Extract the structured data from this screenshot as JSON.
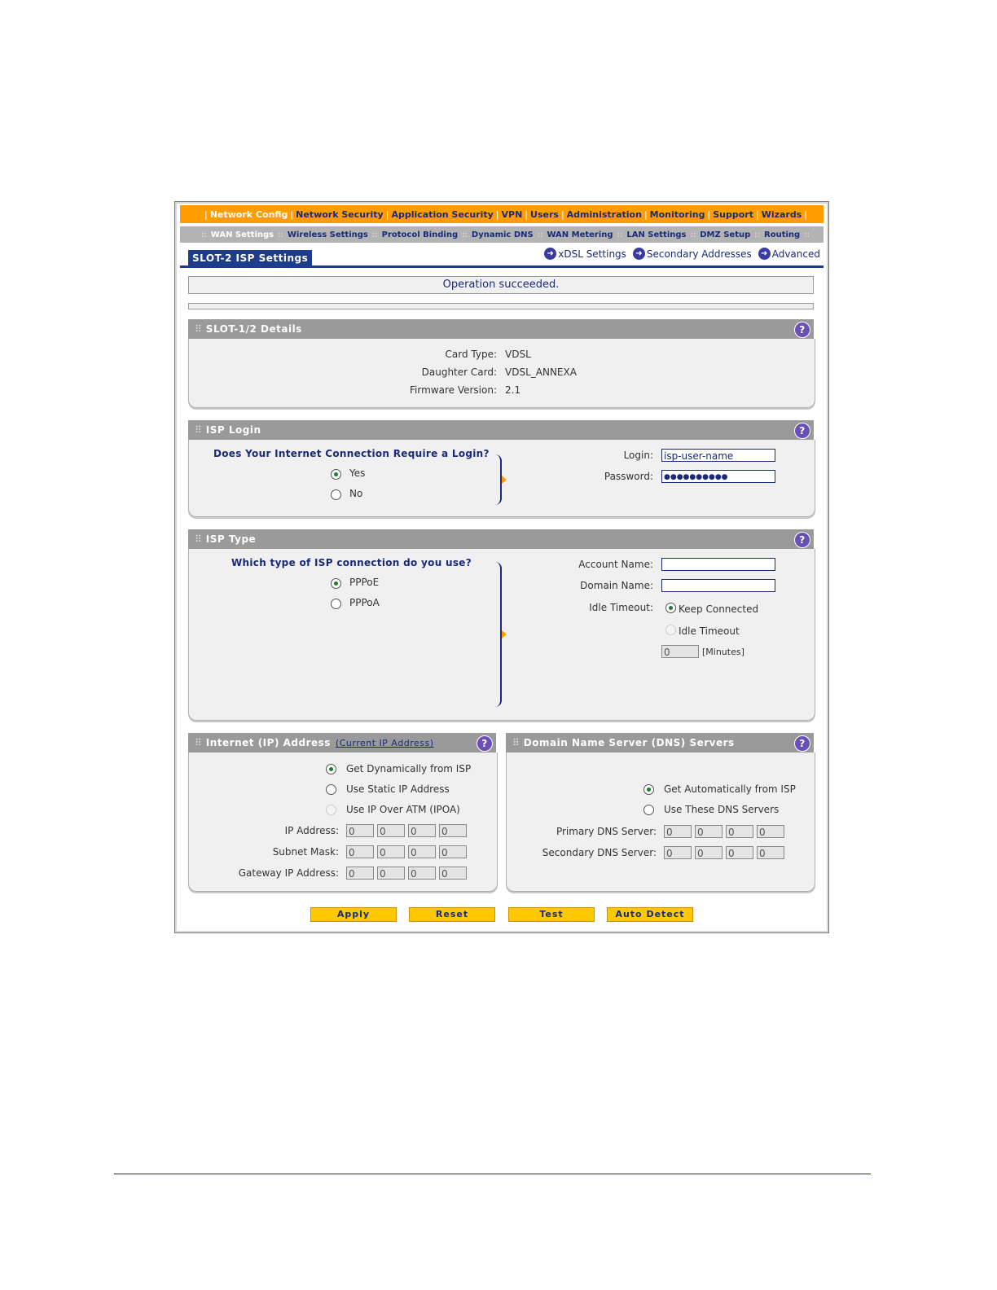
{
  "nav": {
    "primary": [
      "Network Config",
      "Network Security",
      "Application Security",
      "VPN",
      "Users",
      "Administration",
      "Monitoring",
      "Support",
      "Wizards"
    ],
    "secondary": [
      "WAN Settings",
      "Wireless Settings",
      "Protocol Binding",
      "Dynamic DNS",
      "WAN Metering",
      "LAN Settings",
      "DMZ Setup",
      "Routing"
    ]
  },
  "tab": {
    "title": "SLOT-2 ISP Settings"
  },
  "toplinks": {
    "xdsl": "xDSL Settings",
    "secondary": "Secondary Addresses",
    "advanced": "Advanced"
  },
  "message": "Operation succeeded.",
  "details": {
    "title": "SLOT-1/2 Details",
    "card_type_label": "Card Type:",
    "card_type": "VDSL",
    "daughter_card_label": "Daughter Card:",
    "daughter_card": "VDSL_ANNEXA",
    "firmware_label": "Firmware Version:",
    "firmware": "2.1"
  },
  "isp_login": {
    "title": "ISP Login",
    "question": "Does Your Internet Connection Require a Login?",
    "yes": "Yes",
    "no": "No",
    "selected": "Yes",
    "login_label": "Login:",
    "login_value": "isp-user-name",
    "password_label": "Password:",
    "password_value": "●●●●●●●●●●"
  },
  "isp_type": {
    "title": "ISP Type",
    "question": "Which type of ISP connection do you use?",
    "pppoe": "PPPoE",
    "pppoa": "PPPoA",
    "selected": "PPPoE",
    "account_label": "Account Name:",
    "account_value": "",
    "domain_label": "Domain Name:",
    "domain_value": "",
    "idle_label": "Idle Timeout:",
    "keep_connected": "Keep Connected",
    "idle_timeout": "Idle Timeout",
    "minutes_value": "0",
    "minutes_unit": "[Minutes]"
  },
  "ip_address": {
    "title": "Internet (IP) Address",
    "link": "(Current IP Address)",
    "opt_dynamic": "Get Dynamically from ISP",
    "opt_static": "Use Static IP Address",
    "opt_ipoa": "Use IP Over ATM (IPOA)",
    "ip_label": "IP Address:",
    "mask_label": "Subnet Mask:",
    "gateway_label": "Gateway IP Address:",
    "ip": [
      "0",
      "0",
      "0",
      "0"
    ],
    "mask": [
      "0",
      "0",
      "0",
      "0"
    ],
    "gateway": [
      "0",
      "0",
      "0",
      "0"
    ]
  },
  "dns": {
    "title": "Domain Name Server (DNS) Servers",
    "opt_auto": "Get Automatically from ISP",
    "opt_manual": "Use These DNS Servers",
    "primary_label": "Primary DNS Server:",
    "secondary_label": "Secondary DNS Server:",
    "primary": [
      "0",
      "0",
      "0",
      "0"
    ],
    "secondary": [
      "0",
      "0",
      "0",
      "0"
    ]
  },
  "buttons": {
    "apply": "Apply",
    "reset": "Reset",
    "test": "Test",
    "auto_detect": "Auto Detect"
  }
}
